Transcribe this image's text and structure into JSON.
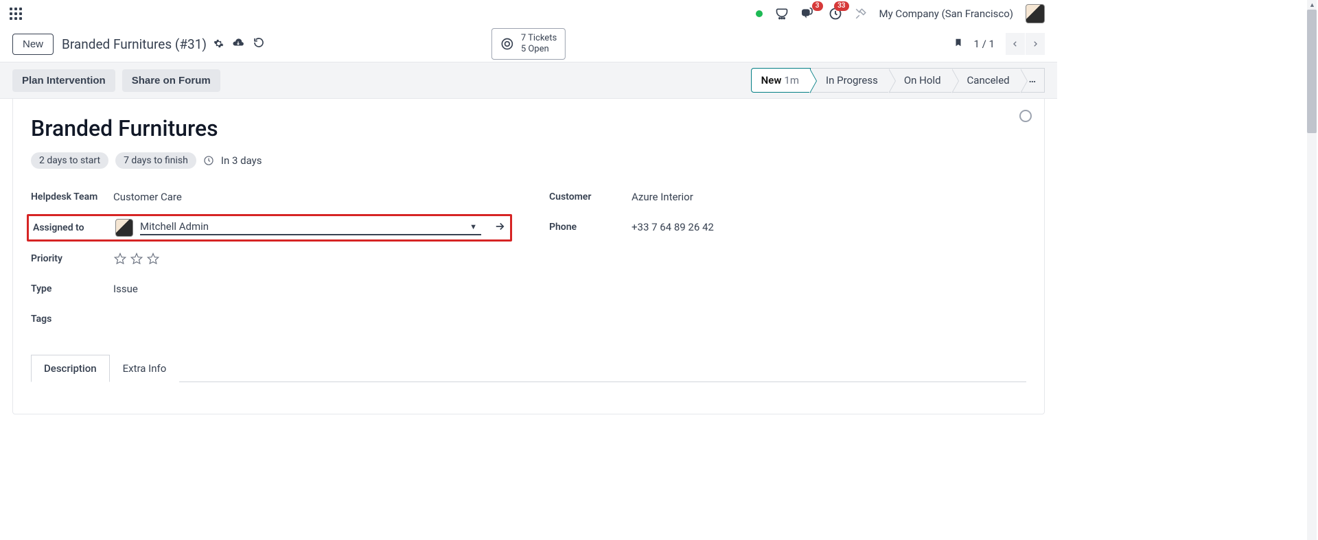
{
  "topbar": {
    "company": "My Company (San Francisco)",
    "messages_badge": "3",
    "activities_badge": "33"
  },
  "action_row": {
    "new_label": "New",
    "breadcrumb": "Branded Furnitures (#31)",
    "tickets_line1": "7  Tickets",
    "tickets_line2": "5  Open",
    "pager": "1 / 1"
  },
  "statusbar": {
    "plan_intervention": "Plan Intervention",
    "share_forum": "Share on Forum",
    "stages": {
      "new": "New",
      "new_sub": "1m",
      "in_progress": "In Progress",
      "on_hold": "On Hold",
      "canceled": "Canceled"
    }
  },
  "form": {
    "title": "Branded Furnitures",
    "days_to_start": "2 days to start",
    "days_to_finish": "7 days to finish",
    "due_text": "In 3 days",
    "labels": {
      "helpdesk_team": "Helpdesk Team",
      "assigned_to": "Assigned to",
      "priority": "Priority",
      "type": "Type",
      "tags": "Tags",
      "customer": "Customer",
      "phone": "Phone"
    },
    "values": {
      "helpdesk_team": "Customer Care",
      "assigned_to": "Mitchell Admin",
      "type": "Issue",
      "customer": "Azure Interior",
      "phone": "+33 7 64 89 26 42"
    }
  },
  "tabs": {
    "description": "Description",
    "extra_info": "Extra Info"
  }
}
